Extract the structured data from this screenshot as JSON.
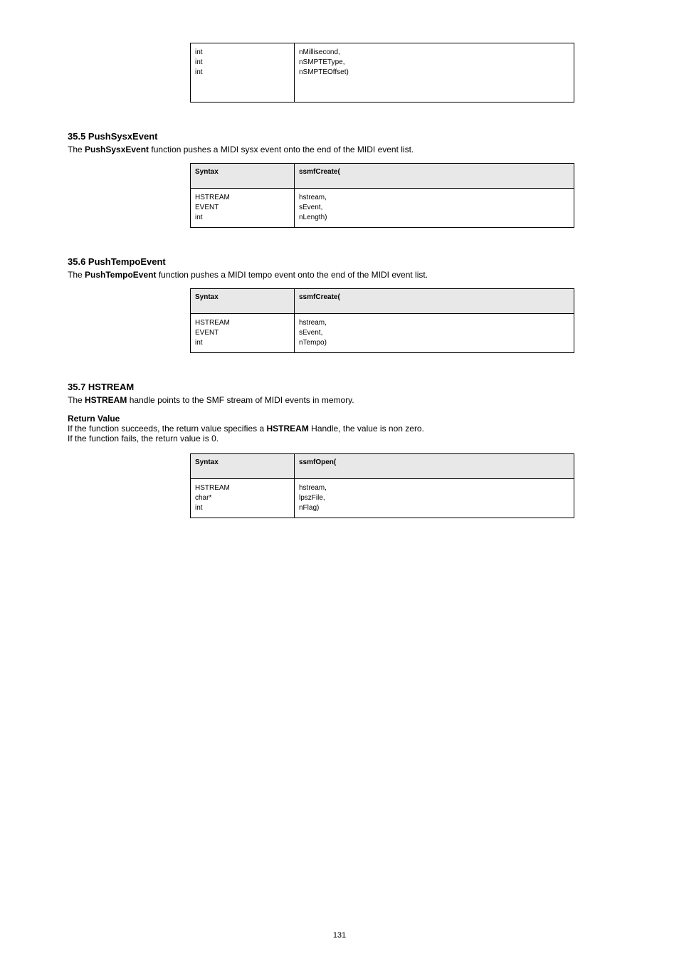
{
  "tbl1": {
    "r1c1a": "int",
    "r1c1b": "int",
    "r1c1c": "int",
    "r1c2a": "nMillisecond,",
    "r1c2b": "nSMPTEType,",
    "r1c2c": "nSMPTEOffset)"
  },
  "sec35": {
    "title": "35.5  PushSysxEvent",
    "desc_pre": "The ",
    "desc_fn": "PushSysxEvent",
    "desc_post": " function pushes a MIDI sysx event onto the end of the MIDI event list.",
    "th1": "Syntax",
    "th2": "ssmfCreate(",
    "r1c1a": "HSTREAM",
    "r1c1b": "EVENT",
    "r1c1c": "int",
    "r1c2a": "hstream,",
    "r1c2b": "sEvent,",
    "r1c2c": "nLength)"
  },
  "sec36": {
    "title": "35.6  PushTempoEvent",
    "desc_pre": "The ",
    "desc_fn": "PushTempoEvent",
    "desc_post": " function pushes a MIDI tempo event onto the end of the MIDI event list.",
    "th1": "Syntax",
    "th2": "ssmfCreate(",
    "r1c1a": "HSTREAM",
    "r1c1b": "EVENT",
    "r1c1c": "int",
    "r1c2a": "hstream,",
    "r1c2b": "sEvent,",
    "r1c2c": "nTempo)"
  },
  "sec37": {
    "title": "35.7  HSTREAM",
    "line1_pre": "The ",
    "line1_bold": "HSTREAM",
    "line1_post": " handle points to the SMF stream of MIDI events in memory.",
    "retlabel": "Return Value",
    "retbody_pre": "If the function succeeds, the return value specifies a ",
    "retbody_mid": "HSTREAM",
    "retbody_post1": " Handle, the value is non zero.",
    "retbody_line2": "If the function fails, the return value is 0.",
    "th1": "Syntax",
    "th2": "ssmfOpen(",
    "r1c1a": "HSTREAM",
    "r1c1b": "char*",
    "r1c1c": "int",
    "r1c2a": "hstream,",
    "r1c2b": "lpszFile,",
    "r1c2c": "nFlag)"
  },
  "page_number": "131"
}
